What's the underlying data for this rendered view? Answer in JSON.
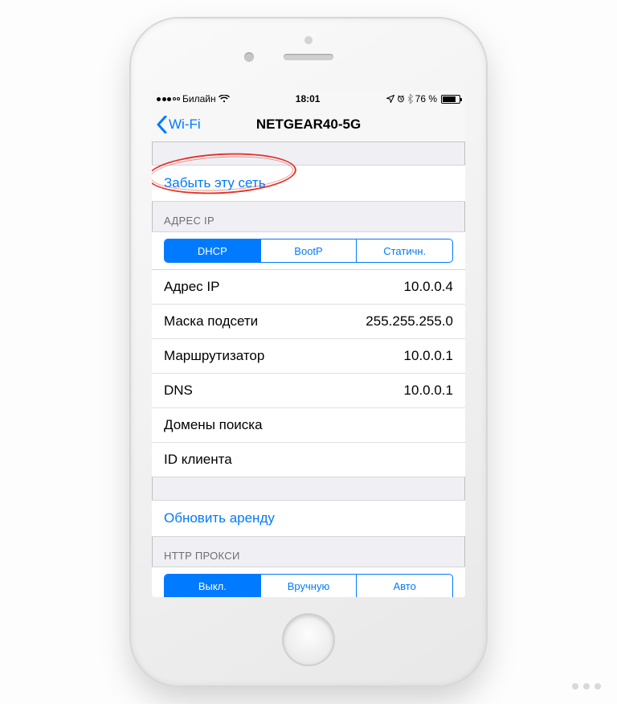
{
  "status": {
    "carrier": "Билайн",
    "time": "18:01",
    "battery_pct": "76 %"
  },
  "nav": {
    "back": "Wi-Fi",
    "title": "NETGEAR40-5G"
  },
  "forget_label": "Забыть эту сеть",
  "ip_section_header": "АДРЕС IP",
  "ip_seg": {
    "dhcp": "DHCP",
    "bootp": "BootP",
    "static": "Статичн."
  },
  "ip_rows": {
    "addr_label": "Адрес IP",
    "addr_val": "10.0.0.4",
    "mask_label": "Маска подсети",
    "mask_val": "255.255.255.0",
    "router_label": "Маршрутизатор",
    "router_val": "10.0.0.1",
    "dns_label": "DNS",
    "dns_val": "10.0.0.1",
    "search_label": "Домены поиска",
    "search_val": "",
    "client_label": "ID клиента",
    "client_val": ""
  },
  "renew_label": "Обновить аренду",
  "proxy_header": "HTTP ПРОКСИ",
  "proxy_seg": {
    "off": "Выкл.",
    "manual": "Вручную",
    "auto": "Авто"
  }
}
